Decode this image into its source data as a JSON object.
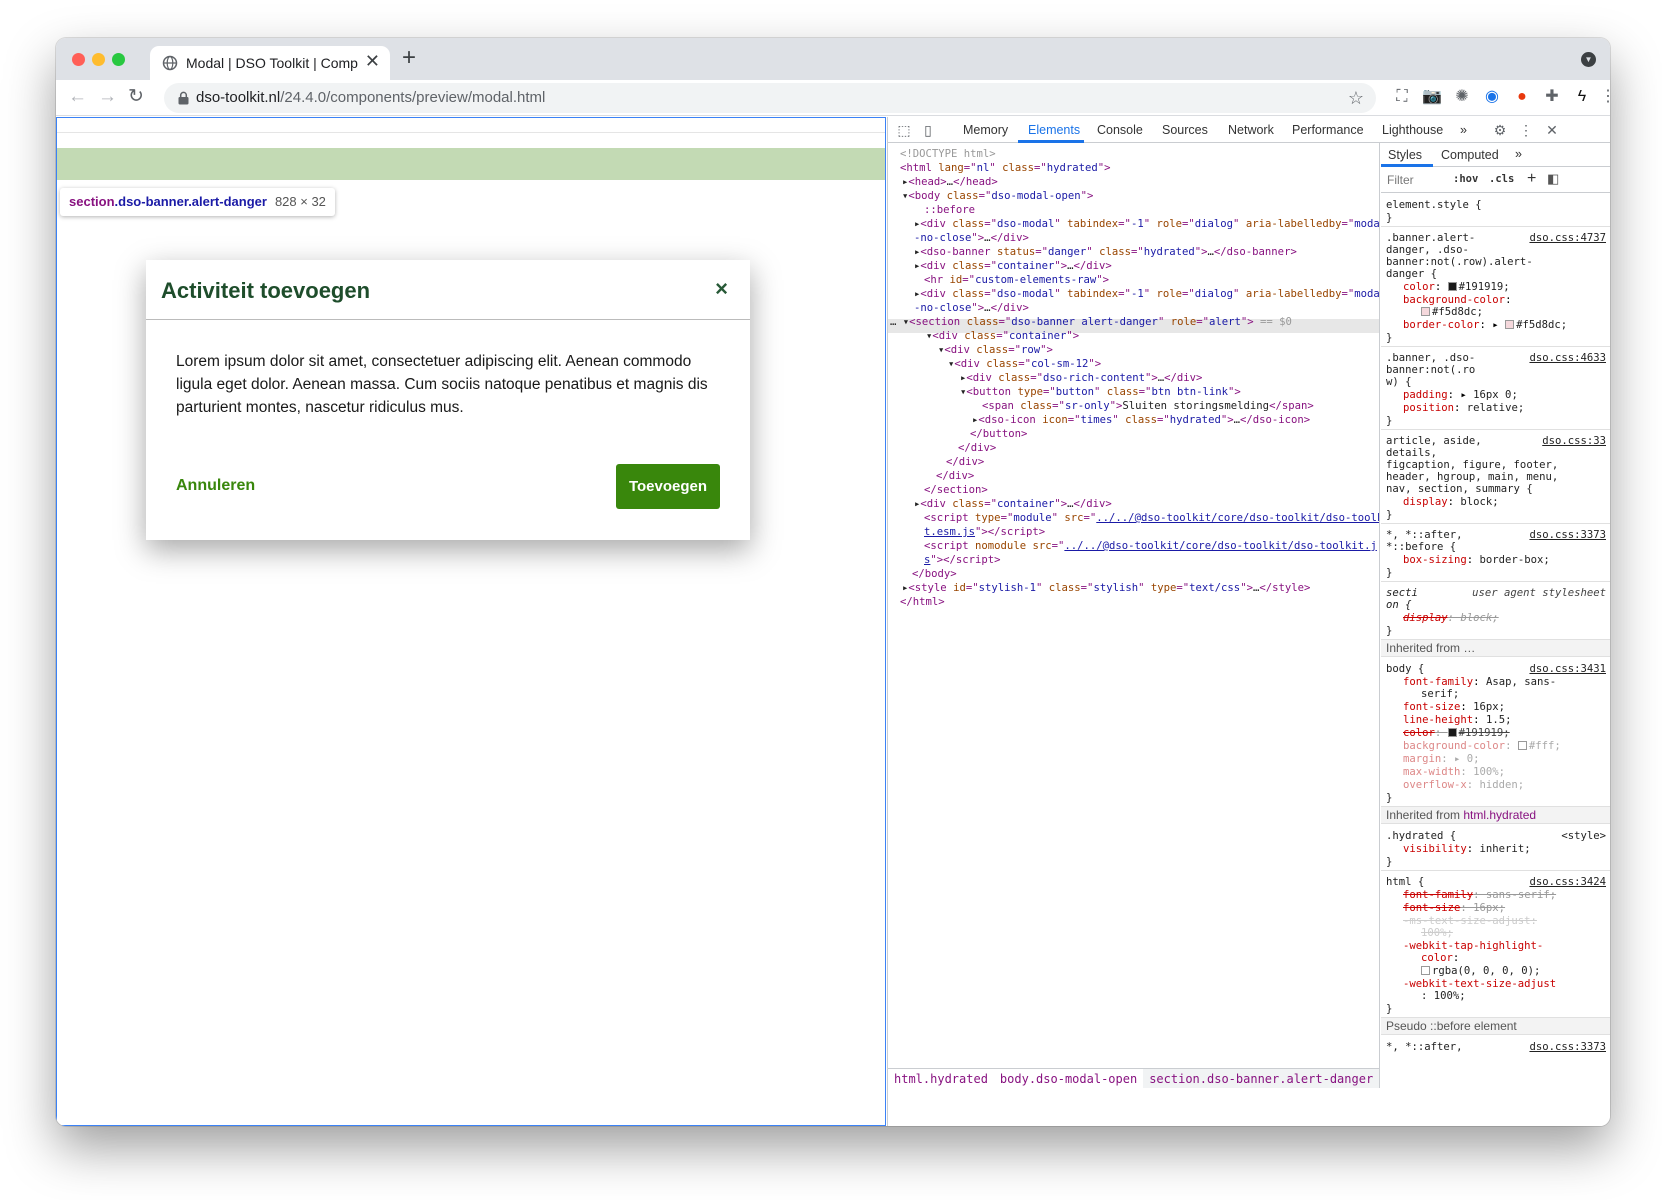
{
  "browser": {
    "tab_title": "Modal | DSO Toolkit | Compone",
    "url_host": "dso-toolkit.nl",
    "url_path": "/24.4.0/components/preview/modal.html",
    "new_tab": "+",
    "close_tab": "✕"
  },
  "page": {
    "tooltip_element": "section",
    "tooltip_class": ".dso-banner.alert-danger",
    "tooltip_size": "828 × 32",
    "modal": {
      "title": "Activiteit toevoegen",
      "close": "×",
      "body": "Lorem ipsum dolor sit amet, consectetuer adipiscing elit. Aenean commodo ligula eget dolor. Aenean massa. Cum sociis natoque penatibus et magnis dis parturient montes, nascetur ridiculus mus.",
      "cancel": "Annuleren",
      "confirm": "Toevoegen"
    }
  },
  "devtools": {
    "tabs": [
      "Memory",
      "Elements",
      "Console",
      "Sources",
      "Network",
      "Performance",
      "Lighthouse"
    ],
    "more": "»",
    "breadcrumbs": [
      "html.hydrated",
      "body.dso-modal-open",
      "section.dso-banner.alert-danger"
    ],
    "styles_tabs": [
      "Styles",
      "Computed"
    ],
    "filter": "Filter",
    "hov": ":hov",
    "cls": ".cls",
    "inherited_1": "Inherited from …",
    "inherited_2_prefix": "Inherited from ",
    "inherited_2_el": "html.hydrated",
    "pseudo": "Pseudo ::before element"
  }
}
